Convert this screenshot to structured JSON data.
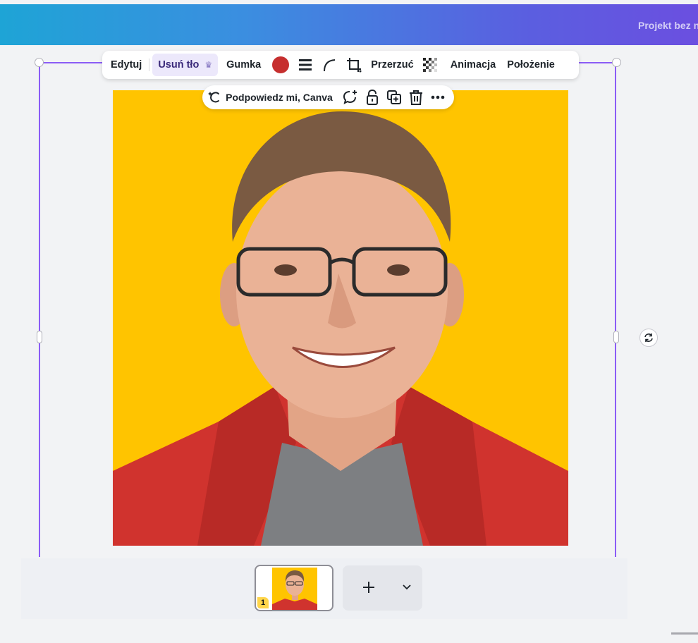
{
  "topbar": {
    "project_title": "Projekt bez n"
  },
  "toolbar": {
    "edit": "Edytuj",
    "remove_bg": "Usuń tło",
    "eraser": "Gumka",
    "color": "#c62f2f",
    "flip": "Przerzuć",
    "animate": "Animacja",
    "position": "Położenie"
  },
  "minibar": {
    "assistant": "Podpowiedz mi, Canva"
  },
  "pages": {
    "current_number": "1"
  },
  "colors": {
    "accent": "#8b5cf6",
    "photo_bg": "#ffc400"
  }
}
